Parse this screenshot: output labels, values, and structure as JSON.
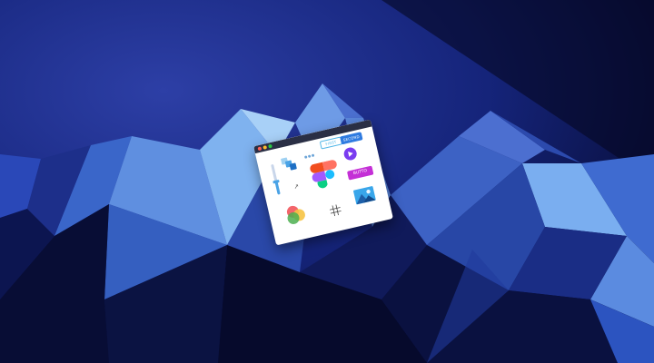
{
  "window": {
    "tabs_dots": [
      "blue-dot",
      "blue-dot",
      "blue-dot"
    ],
    "first_button": "FIRST",
    "second_button": "SECOND",
    "button_chip": "BUTTO",
    "slider_level": 0.55
  },
  "colors": {
    "background": "#1b2d78",
    "accent_blue": "#2f7be0",
    "accent_purple": "#7a3cf0",
    "accent_magenta": "#c42fd6"
  },
  "icons": [
    "cubes-icon",
    "cursor-icon",
    "figma-icon",
    "play-icon",
    "colors-icon",
    "grid-icon",
    "image-icon"
  ]
}
